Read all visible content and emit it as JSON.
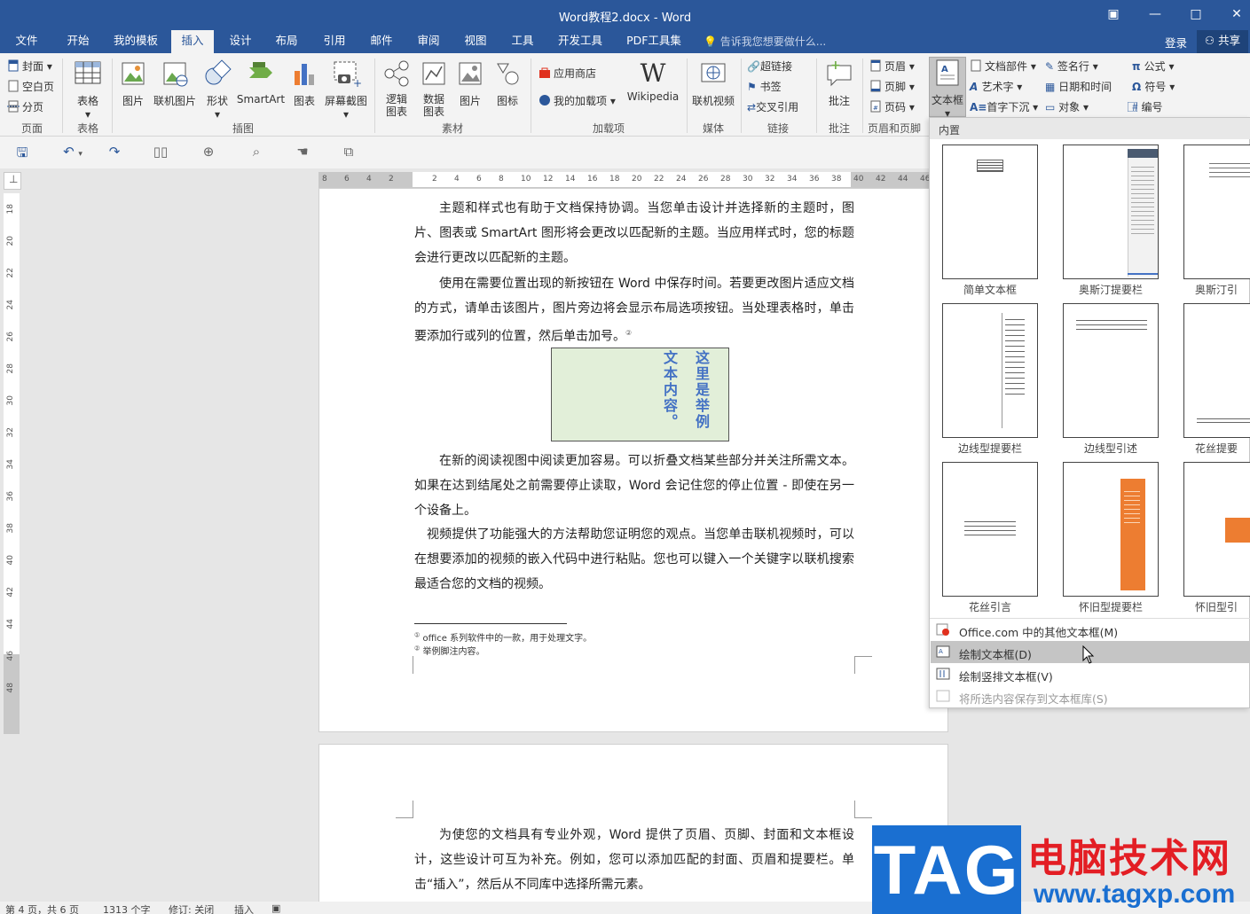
{
  "window": {
    "title": "Word教程2.docx - Word"
  },
  "menu": {
    "tabs": [
      "文件",
      "开始",
      "我的模板",
      "插入",
      "设计",
      "布局",
      "引用",
      "邮件",
      "审阅",
      "视图",
      "工具",
      "开发工具",
      "PDF工具集"
    ],
    "active": "插入",
    "tell_me": "告诉我您想要做什么...",
    "login": "登录",
    "share": "共享"
  },
  "ribbon": {
    "pages": {
      "cover": "封面",
      "blank": "空白页",
      "break": "分页",
      "label": "页面"
    },
    "tables": {
      "table": "表格",
      "label": "表格"
    },
    "illustrations": {
      "picture": "图片",
      "online_picture": "联机图片",
      "shapes": "形状",
      "smartart": "SmartArt",
      "chart": "图表",
      "screenshot": "屏幕截图",
      "label": "插图"
    },
    "material": {
      "logic": "逻辑图表",
      "data": "数据图表",
      "picture": "图片",
      "icon": "图标",
      "label": "素材"
    },
    "addins": {
      "store": "应用商店",
      "my_addins": "我的加载项",
      "wikipedia": "Wikipedia",
      "label": "加载项"
    },
    "media": {
      "online_video": "联机视频",
      "label": "媒体"
    },
    "links": {
      "hyperlink": "超链接",
      "bookmark": "书签",
      "cross_ref": "交叉引用",
      "label": "链接"
    },
    "comments": {
      "comment": "批注",
      "label": "批注"
    },
    "header_footer": {
      "header": "页眉",
      "footer": "页脚",
      "page_number": "页码",
      "label": "页眉和页脚"
    },
    "text": {
      "textbox": "文本框",
      "doc_parts": "文档部件",
      "wordart": "艺术字",
      "dropcap": "首字下沉",
      "signature": "签名行",
      "datetime": "日期和时间",
      "object": "对象"
    },
    "symbols": {
      "equation": "公式",
      "symbol": "符号",
      "number": "编号"
    }
  },
  "ruler": {
    "h_ticks": [
      "8",
      "6",
      "4",
      "2",
      "2",
      "4",
      "6",
      "8",
      "10",
      "12",
      "14",
      "16",
      "18",
      "20",
      "22",
      "24",
      "26",
      "28",
      "30",
      "32",
      "34",
      "36",
      "38",
      "40",
      "42",
      "44",
      "46"
    ],
    "v_ticks": [
      "18",
      "20",
      "22",
      "24",
      "26",
      "28",
      "30",
      "32",
      "34",
      "36",
      "38",
      "40",
      "42",
      "44",
      "46",
      "48"
    ]
  },
  "document": {
    "p1": "主题和样式也有助于文档保持协调。当您单击设计并选择新的主题时，图片、图表或 SmartArt 图形将会更改以匹配新的主题。当应用样式时，您的标题会进行更改以匹配新的主题。",
    "p2": "使用在需要位置出现的新按钮在 Word 中保存时间。若要更改图片适应文档的方式，请单击该图片，图片旁边将会显示布局选项按钮。当处理表格时，单击要添加行或列的位置，然后单击加号。",
    "p2_note": "②",
    "textbox_col1": "这里是举例",
    "textbox_col2": "文本内容。",
    "p3": "在新的阅读视图中阅读更加容易。可以折叠文档某些部分并关注所需文本。如果在达到结尾处之前需要停止读取，Word 会记住您的停止位置 - 即使在另一个设备上。",
    "p4": "视频提供了功能强大的方法帮助您证明您的观点。当您单击联机视频时，可以在想要添加的视频的嵌入代码中进行粘贴。您也可以键入一个关键字以联机搜索最适合您的文档的视频。",
    "fn1_mark": "①",
    "fn1": "office 系列软件中的一款，用于处理文字。",
    "fn2_mark": "②",
    "fn2": "举例脚注内容。",
    "p5": "为使您的文档具有专业外观，Word 提供了页眉、页脚、封面和文本框设计，这些设计可互为补充。例如，您可以添加匹配的封面、页眉和提要栏。单击“插入”，然后从不同库中选择所需元素。"
  },
  "gallery": {
    "header": "内置",
    "items": [
      "简单文本框",
      "奥斯汀提要栏",
      "奥斯汀引",
      "边线型提要栏",
      "边线型引述",
      "花丝提要",
      "花丝引言",
      "怀旧型提要栏",
      "怀旧型引"
    ],
    "menu": [
      {
        "label": "Office.com 中的其他文本框(M)",
        "enabled": true
      },
      {
        "label": "绘制文本框(D)",
        "enabled": true
      },
      {
        "label": "绘制竖排文本框(V)",
        "enabled": true
      },
      {
        "label": "将所选内容保存到文本框库(S)",
        "enabled": false
      }
    ]
  },
  "statusbar": {
    "page": "第 4 页，共 6 页",
    "words": "1313 个字",
    "track": "修订: 关闭",
    "mode": "插入"
  },
  "watermark": {
    "tag": "TAG",
    "site": "电脑技术网",
    "url": "www.tagxp.com"
  },
  "colors": {
    "brand": "#2b579a",
    "textbox_fill": "#e2efd9",
    "textbox_text": "#4472c4",
    "accent_orange": "#ed7d31"
  }
}
